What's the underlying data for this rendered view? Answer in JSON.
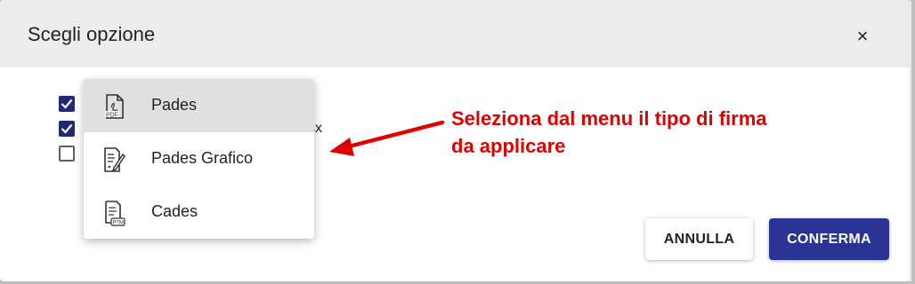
{
  "dialog": {
    "title": "Scegli opzione",
    "close_glyph": "×"
  },
  "file_list": {
    "checkboxes": [
      {
        "checked": true
      },
      {
        "checked": true
      },
      {
        "checked": false
      }
    ],
    "partial_text": "sx"
  },
  "signature_menu": {
    "items": [
      {
        "label": "Pades",
        "icon": "pdf-file-icon",
        "highlighted": true
      },
      {
        "label": "Pades Grafico",
        "icon": "signed-document-icon",
        "highlighted": false
      },
      {
        "label": "Cades",
        "icon": "p7m-file-icon",
        "highlighted": false
      }
    ]
  },
  "annotation": {
    "line1": "Seleziona dal menu il tipo di firma",
    "line2": "da applicare",
    "color": "#e00000"
  },
  "actions": {
    "cancel_label": "ANNULLA",
    "confirm_label": "CONFERMA",
    "confirm_color": "#2a3494"
  }
}
